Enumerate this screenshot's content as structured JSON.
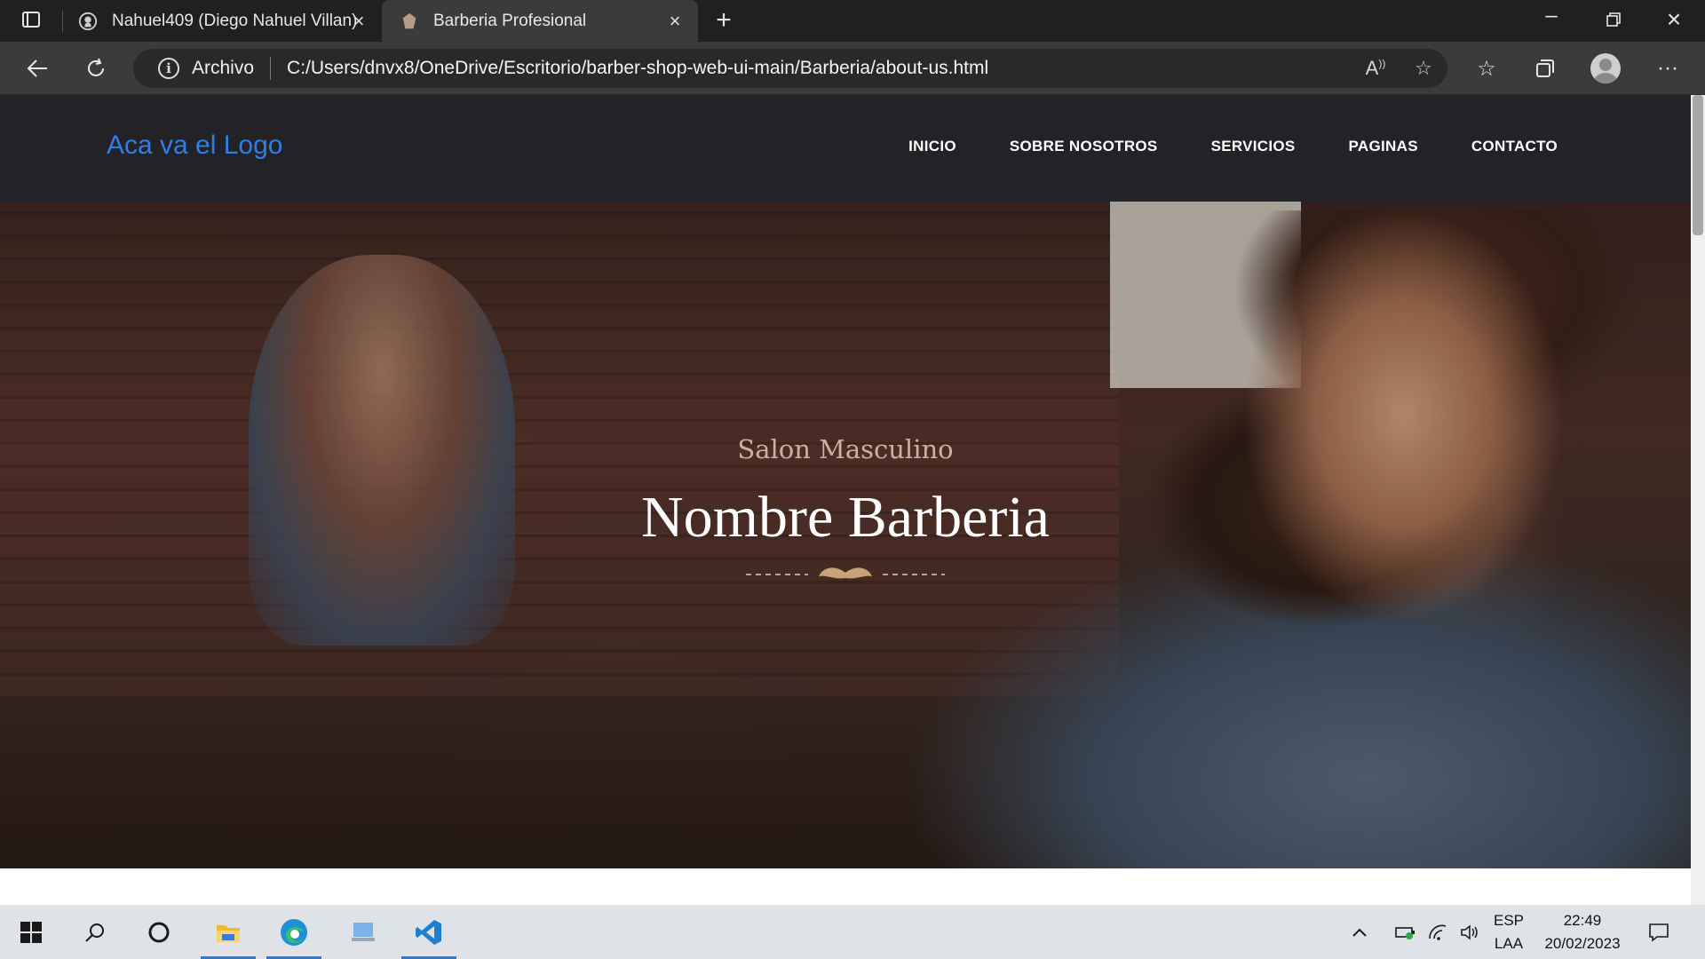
{
  "browser": {
    "tabs": [
      {
        "title": "Nahuel409 (Diego Nahuel Villan)",
        "icon": "github-icon",
        "active": false
      },
      {
        "title": "Barberia Profesional",
        "icon": "barber-favicon-icon",
        "active": true
      }
    ],
    "address_bar": {
      "scheme_label": "Archivo",
      "url": "C:/Users/dnvx8/OneDrive/Escritorio/barber-shop-web-ui-main/Barberia/about-us.html"
    }
  },
  "site": {
    "logo_text": "Aca va el Logo",
    "menu": [
      "INICIO",
      "SOBRE NOSOTROS",
      "SERVICIOS",
      "PAGINAS",
      "CONTACTO"
    ],
    "hero": {
      "subtitle": "Salon Masculino",
      "title": "Nombre Barberia",
      "divider_icon": "mustache-icon"
    },
    "colors": {
      "logo": "#2f7fe6",
      "header_bg": "#222227",
      "accent": "#c9a27a"
    }
  },
  "taskbar": {
    "language": "ESP",
    "layout": "LAA",
    "time": "22:49",
    "date": "20/02/2023"
  }
}
